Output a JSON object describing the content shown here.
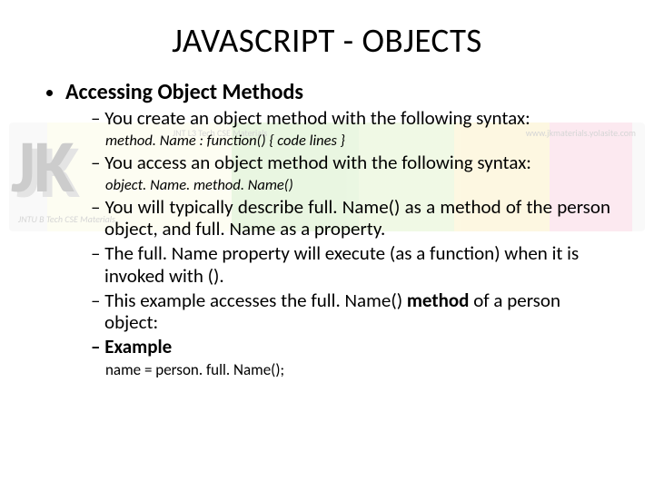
{
  "title": "JAVASCRIPT - OBJECTS",
  "heading": "Accessing Object Methods",
  "bullets": {
    "b1": "You create an object method with the following syntax:",
    "code1": "method. Name : function() { code lines }",
    "b2": "You access an object method with the following syntax:",
    "code2": "object. Name. method. Name()",
    "b3": "You will typically describe full. Name() as a method of the person object, and full. Name as a property.",
    "b4": "The full. Name property will execute (as a function) when it is invoked with ().",
    "b5_pre": "This example accesses the full. Name() ",
    "b5_bold": "method",
    "b5_post": " of a person object:",
    "b6": "Example",
    "code3": "name = person. full. Name();"
  },
  "watermark": {
    "jk": "JK",
    "sub": "JNTU B Tech CSE Materials",
    "mid": "JNT L3 Tech CSE Materials",
    "right": "www.jkmaterials.yolasite.com"
  }
}
